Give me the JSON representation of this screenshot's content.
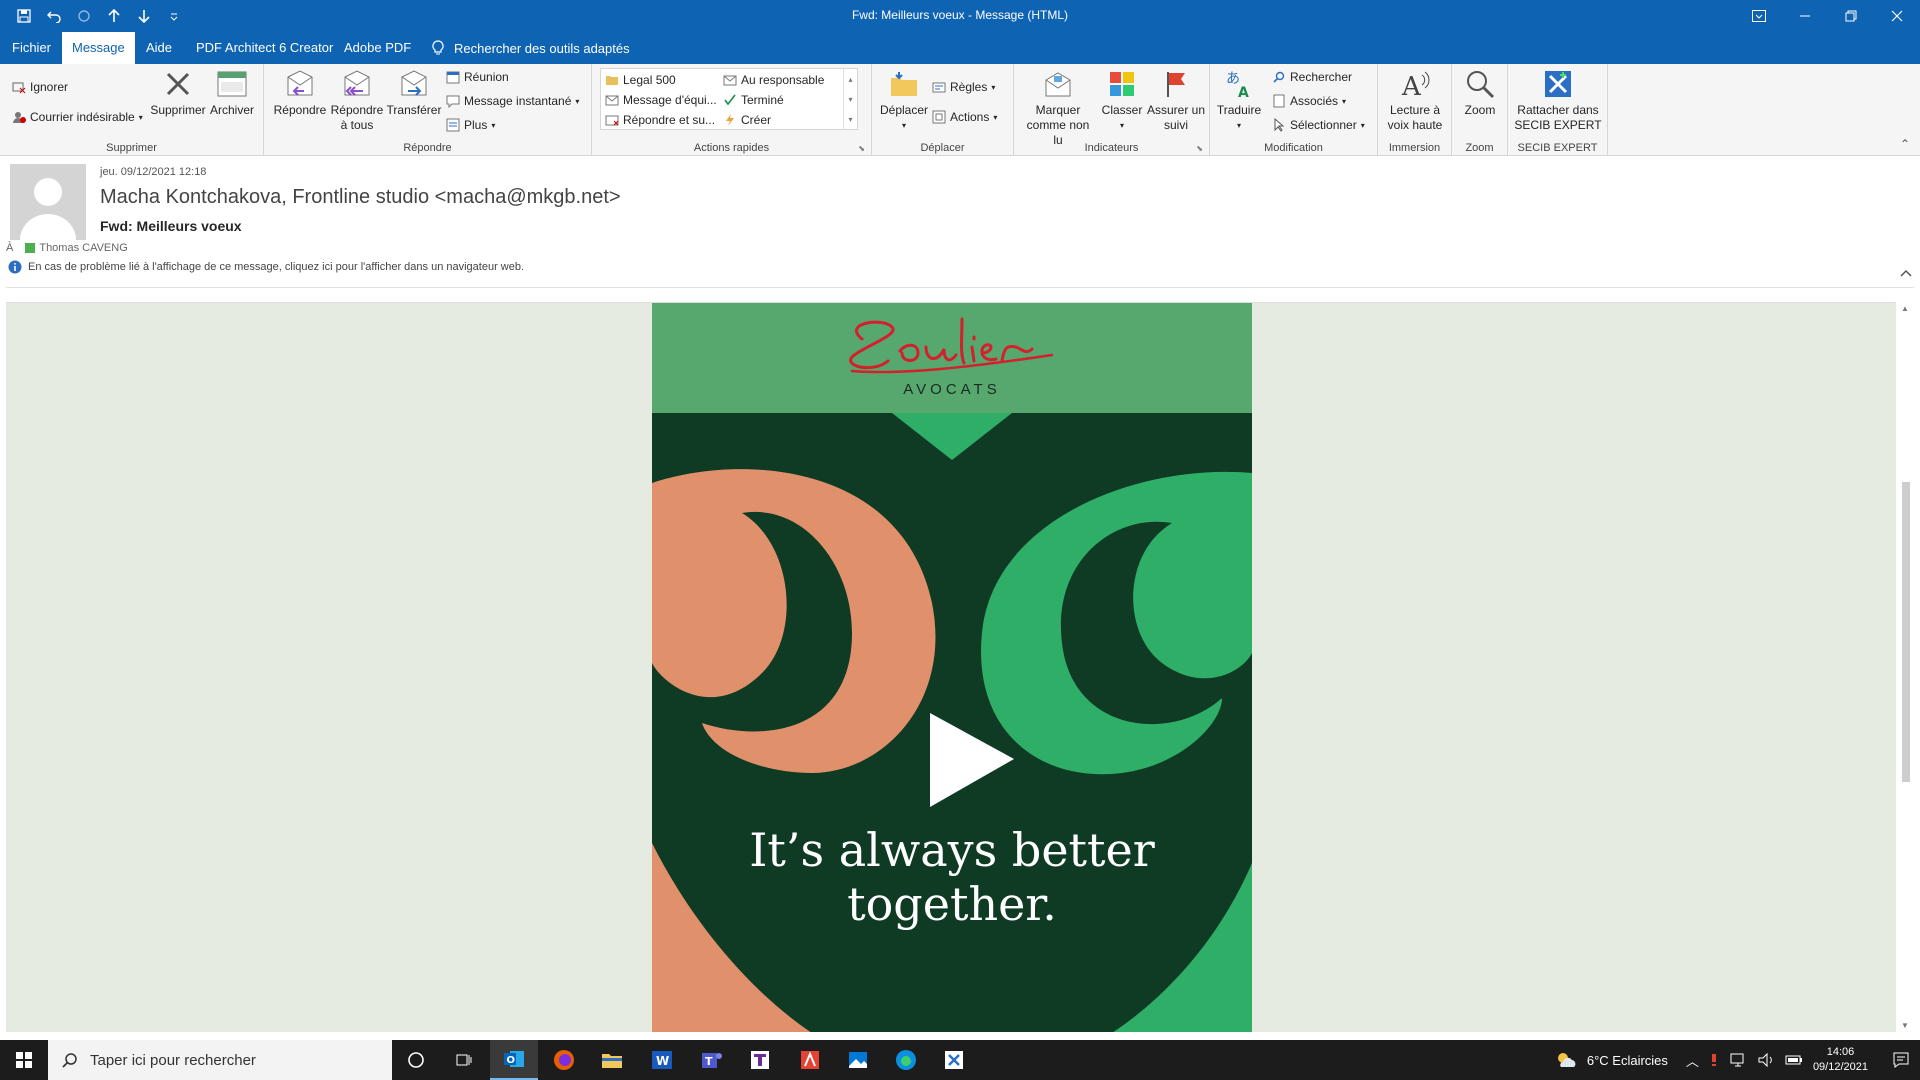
{
  "window": {
    "title": "Fwd: Meilleurs voeux  -  Message (HTML)"
  },
  "tabs": [
    {
      "label": "Fichier"
    },
    {
      "label": "Message"
    },
    {
      "label": "Aide"
    },
    {
      "label": "PDF Architect 6 Creator"
    },
    {
      "label": "Adobe PDF"
    }
  ],
  "tellme": "Rechercher des outils adaptés",
  "ribbon": {
    "supprimer": {
      "label": "Supprimer",
      "ignore": "Ignorer",
      "junk": "Courrier indésirable",
      "delete": "Supprimer",
      "archive": "Archiver"
    },
    "repondre": {
      "label": "Répondre",
      "reply": "Répondre",
      "reply_all_1": "Répondre",
      "reply_all_2": "à tous",
      "forward": "Transférer",
      "meeting": "Réunion",
      "im": "Message instantané",
      "more": "Plus"
    },
    "quick_steps": {
      "label": "Actions rapides",
      "items": [
        "Legal 500",
        "Au responsable",
        "Message d'équi...",
        "Terminé",
        "Répondre et su...",
        "Créer"
      ]
    },
    "deplacer": {
      "label": "Déplacer",
      "move": "Déplacer",
      "rules": "Règles",
      "actions": "Actions"
    },
    "indicateurs": {
      "label": "Indicateurs",
      "mark_unread_1": "Marquer",
      "mark_unread_2": "comme non lu",
      "categorize": "Classer",
      "followup_1": "Assurer un",
      "followup_2": "suivi"
    },
    "modification": {
      "label": "Modification",
      "translate": "Traduire",
      "find": "Rechercher",
      "related": "Associés",
      "select": "Sélectionner"
    },
    "immersion": {
      "label": "Immersion",
      "read_aloud_1": "Lecture à",
      "read_aloud_2": "voix haute"
    },
    "zoom": {
      "label": "Zoom",
      "zoom": "Zoom"
    },
    "secib": {
      "label": "SECIB EXPERT",
      "attach_1": "Rattacher dans",
      "attach_2": "SECIB EXPERT"
    }
  },
  "message": {
    "date": "jeu. 09/12/2021 12:18",
    "from": "Macha Kontchakova, Frontline studio <macha@mkgb.net>",
    "subject": "Fwd: Meilleurs voeux",
    "to_label": "À",
    "to": "Thomas CAVENG",
    "info": "En cas de problème lié à l'affichage de ce message, cliquez ici pour l'afficher dans un navigateur web."
  },
  "email_content": {
    "logo_script": "Soulier",
    "logo_sub": "AVOCATS",
    "tagline_1": "It’s always better",
    "tagline_2": "together."
  },
  "taskbar": {
    "search_placeholder": "Taper ici pour rechercher",
    "weather": "6°C  Eclaircies",
    "time": "14:06",
    "date": "09/12/2021"
  },
  "colors": {
    "accent": "#0f63b3",
    "card_top": "#57a86e",
    "card_bg": "#0f3b24",
    "salmon": "#e0906b",
    "green": "#2fae68"
  }
}
